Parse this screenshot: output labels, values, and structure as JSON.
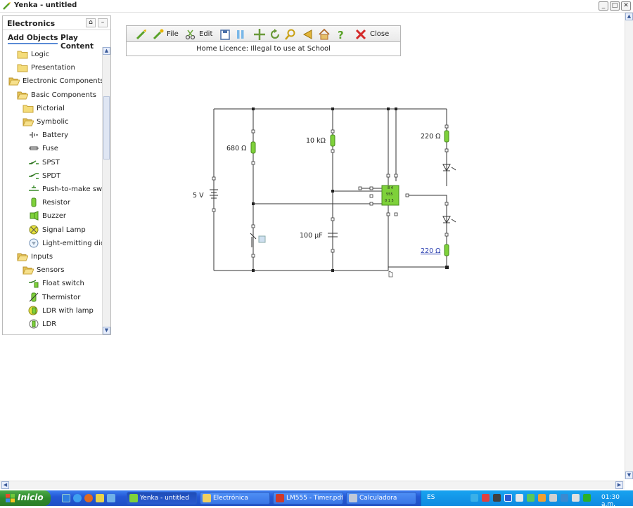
{
  "window": {
    "title": "Yenka - untitled",
    "controls": {
      "minimize": "_",
      "maximize": "□",
      "close": "✕"
    }
  },
  "panel": {
    "title": "Electronics",
    "tabs": [
      {
        "label": "Add Objects",
        "active": true
      },
      {
        "label": "Play Content",
        "active": false
      }
    ],
    "tree": [
      {
        "label": "Logic",
        "icon": "folder-icon",
        "depth": 1
      },
      {
        "label": "Presentation",
        "icon": "folder-icon",
        "depth": 1
      },
      {
        "label": "Electronic Components",
        "icon": "open-folder-icon",
        "depth": 0
      },
      {
        "label": "Basic Components",
        "icon": "open-folder-icon",
        "depth": 1
      },
      {
        "label": "Pictorial",
        "icon": "folder-icon",
        "depth": 2
      },
      {
        "label": "Symbolic",
        "icon": "open-folder-icon",
        "depth": 2
      },
      {
        "label": "Battery",
        "icon": "battery-icon",
        "depth": 3
      },
      {
        "label": "Fuse",
        "icon": "fuse-icon",
        "depth": 3
      },
      {
        "label": "SPST",
        "icon": "spst-switch-icon",
        "depth": 3
      },
      {
        "label": "SPDT",
        "icon": "spdt-switch-icon",
        "depth": 3
      },
      {
        "label": "Push-to-make sw...",
        "icon": "push-switch-icon",
        "depth": 3
      },
      {
        "label": "Resistor",
        "icon": "resistor-icon",
        "depth": 3
      },
      {
        "label": "Buzzer",
        "icon": "buzzer-icon",
        "depth": 3
      },
      {
        "label": "Signal Lamp",
        "icon": "signal-lamp-icon",
        "depth": 3
      },
      {
        "label": "Light-emitting dio...",
        "icon": "led-icon",
        "depth": 3
      },
      {
        "label": "Inputs",
        "icon": "open-folder-icon",
        "depth": 1
      },
      {
        "label": "Sensors",
        "icon": "open-folder-icon",
        "depth": 2
      },
      {
        "label": "Float switch",
        "icon": "float-switch-icon",
        "depth": 3
      },
      {
        "label": "Thermistor",
        "icon": "thermistor-icon",
        "depth": 3
      },
      {
        "label": "LDR with lamp",
        "icon": "ldr-lamp-icon",
        "depth": 3
      },
      {
        "label": "LDR",
        "icon": "ldr-icon",
        "depth": 3
      }
    ]
  },
  "toolbar": {
    "file_label": "File",
    "edit_label": "Edit",
    "close_label": "Close",
    "licence_text": "Home Licence: Illegal to use at School"
  },
  "circuit": {
    "battery_label": "5 V",
    "r1_label": "680 Ω",
    "r2_label": "10 kΩ",
    "r3_label": "220 Ω",
    "r4_label": "220 Ω",
    "capacitor_label": "100 µF",
    "ic_label": "555",
    "ic_pins_top": "8 4",
    "ic_pins_bottom": "0 1 5"
  },
  "taskbar": {
    "start_label": "Inicio",
    "tasks": [
      {
        "label": "Yenka - untitled",
        "active": true
      },
      {
        "label": "Electrónica",
        "active": false
      },
      {
        "label": "LM555 - Timer.pdf ...",
        "active": false
      },
      {
        "label": "Calculadora",
        "active": false
      }
    ],
    "language": "ES",
    "clock": "01:30 a.m."
  },
  "colors": {
    "accent": "#5a8bd6",
    "component_green": "#7ed13a",
    "taskbar_blue": "#2458d6",
    "start_green": "#2f8a2c",
    "close_red": "#d42a2a"
  }
}
